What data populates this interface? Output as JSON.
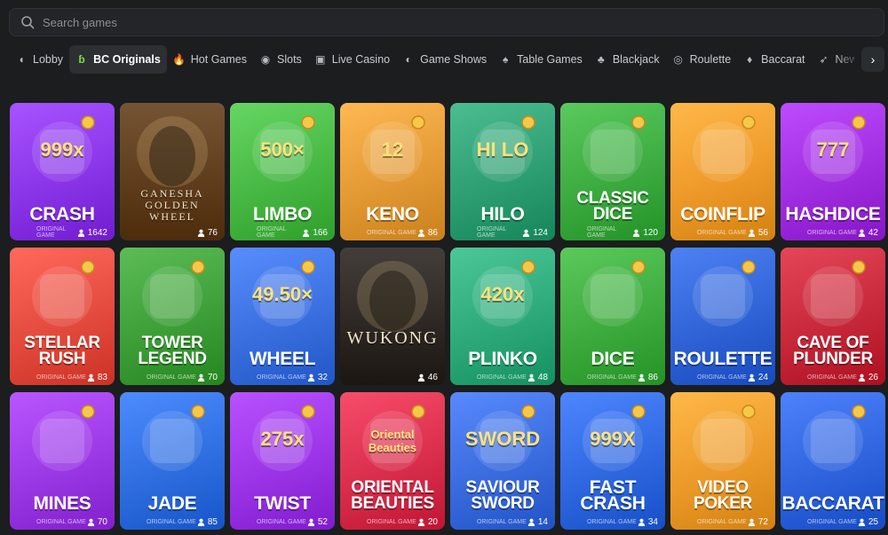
{
  "search": {
    "placeholder": "Search games"
  },
  "tabs": [
    {
      "label": "Lobby",
      "icon": "chevron-icon"
    },
    {
      "label": "BC Originals",
      "icon": "bc-logo-icon"
    },
    {
      "label": "Hot Games",
      "icon": "flame-icon"
    },
    {
      "label": "Slots",
      "icon": "slots-icon"
    },
    {
      "label": "Live Casino",
      "icon": "live-icon"
    },
    {
      "label": "Game Shows",
      "icon": "wheel-icon"
    },
    {
      "label": "Table Games",
      "icon": "cards-icon"
    },
    {
      "label": "Blackjack",
      "icon": "spade-icon"
    },
    {
      "label": "Roulette",
      "icon": "roulette-icon"
    },
    {
      "label": "Baccarat",
      "icon": "baccarat-icon"
    },
    {
      "label": "New Releases",
      "icon": "rocket-icon"
    }
  ],
  "tab_visible_last": "New Releas",
  "footer_label": "ORIGINAL GAME",
  "games": [
    {
      "title": "CRASH",
      "players": "1642",
      "color": "#8a35e8",
      "art": "999x"
    },
    {
      "title": "",
      "players": "76",
      "color": "#6b4a2a",
      "art": "GANESHA GOLDEN WHEEL",
      "dark": true
    },
    {
      "title": "LIMBO",
      "players": "166",
      "color": "#48b845",
      "art": "500×"
    },
    {
      "title": "KENO",
      "players": "86",
      "color": "#e39a35",
      "art": "12"
    },
    {
      "title": "HILO",
      "players": "124",
      "color": "#2e9f72",
      "art": "HI LO"
    },
    {
      "title": "CLASSIC DICE",
      "players": "120",
      "color": "#3cab40",
      "art": ""
    },
    {
      "title": "COINFLIP",
      "players": "56",
      "color": "#ee9a2a",
      "art": ""
    },
    {
      "title": "HASHDICE",
      "players": "42",
      "color": "#a02ee0",
      "art": "777"
    },
    {
      "title": "STELLAR RUSH",
      "players": "83",
      "color": "#e44b3e",
      "art": ""
    },
    {
      "title": "TOWER LEGEND",
      "players": "70",
      "color": "#3e9f38",
      "art": ""
    },
    {
      "title": "WHEEL",
      "players": "32",
      "color": "#3a6fe0",
      "art": "49.50×"
    },
    {
      "title": "",
      "players": "46",
      "color": "#3a3430",
      "art": "WUKONG",
      "dark": true
    },
    {
      "title": "PLINKO",
      "players": "48",
      "color": "#2eaa7a",
      "art": "420x"
    },
    {
      "title": "DICE",
      "players": "86",
      "color": "#3dab3e",
      "art": ""
    },
    {
      "title": "ROULETTE",
      "players": "24",
      "color": "#2f63d6",
      "art": ""
    },
    {
      "title": "CAVE OF PLUNDER",
      "players": "26",
      "color": "#c7283a",
      "art": ""
    },
    {
      "title": "MINES",
      "players": "70",
      "color": "#9b38e6",
      "art": ""
    },
    {
      "title": "JADE",
      "players": "85",
      "color": "#2f6ee0",
      "art": ""
    },
    {
      "title": "TWIST",
      "players": "52",
      "color": "#9a34e6",
      "art": "275x"
    },
    {
      "title": "ORIENTAL BEAUTIES",
      "players": "20",
      "color": "#d92e4c",
      "art": "Oriental Beauties"
    },
    {
      "title": "SAVIOUR SWORD",
      "players": "14",
      "color": "#3a6cdf",
      "art": "SWORD"
    },
    {
      "title": "FAST CRASH",
      "players": "34",
      "color": "#2f68e0",
      "art": "999X"
    },
    {
      "title": "VIDEO POKER",
      "players": "72",
      "color": "#ec9a2a",
      "art": ""
    },
    {
      "title": "BACCARAT",
      "players": "25",
      "color": "#2f64de",
      "art": ""
    }
  ]
}
